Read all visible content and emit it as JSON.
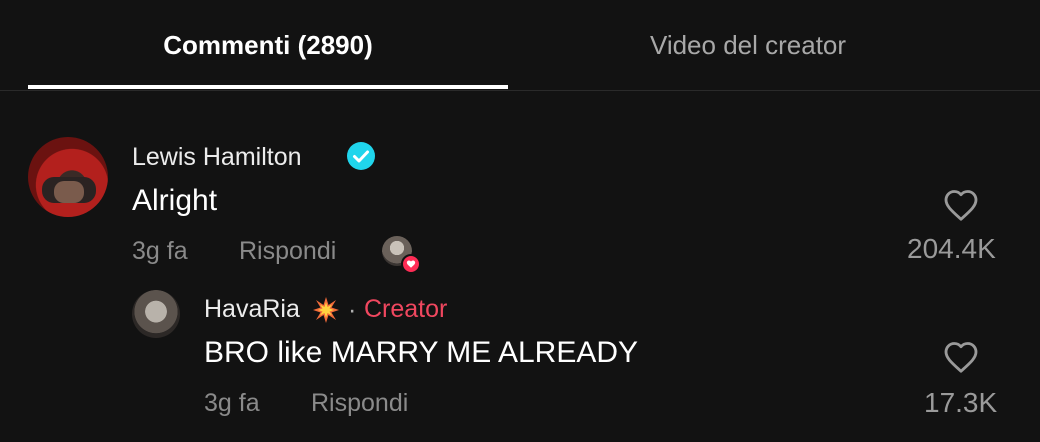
{
  "tabs": [
    {
      "label": "Commenti (2890)",
      "active": true
    },
    {
      "label": "Video del creator",
      "active": false
    }
  ],
  "comment": {
    "username": "Lewis Hamilton",
    "verified": true,
    "text": "Alright",
    "time": "3g fa",
    "reply_label": "Rispondi",
    "liked_by_creator": true,
    "like_count": "204.4K"
  },
  "reply": {
    "username": "HavaRia",
    "username_emoji_icon": "collision-burst-icon",
    "separator": "·",
    "badge": "Creator",
    "text": "BRO like MARRY ME ALREADY",
    "time": "3g fa",
    "reply_label": "Rispondi",
    "like_count": "17.3K"
  },
  "colors": {
    "background": "#121212",
    "accent": "#fe2c55",
    "creator_badge": "#f0475f",
    "verified": "#20d5ec",
    "muted_text": "#8a8a8a"
  }
}
